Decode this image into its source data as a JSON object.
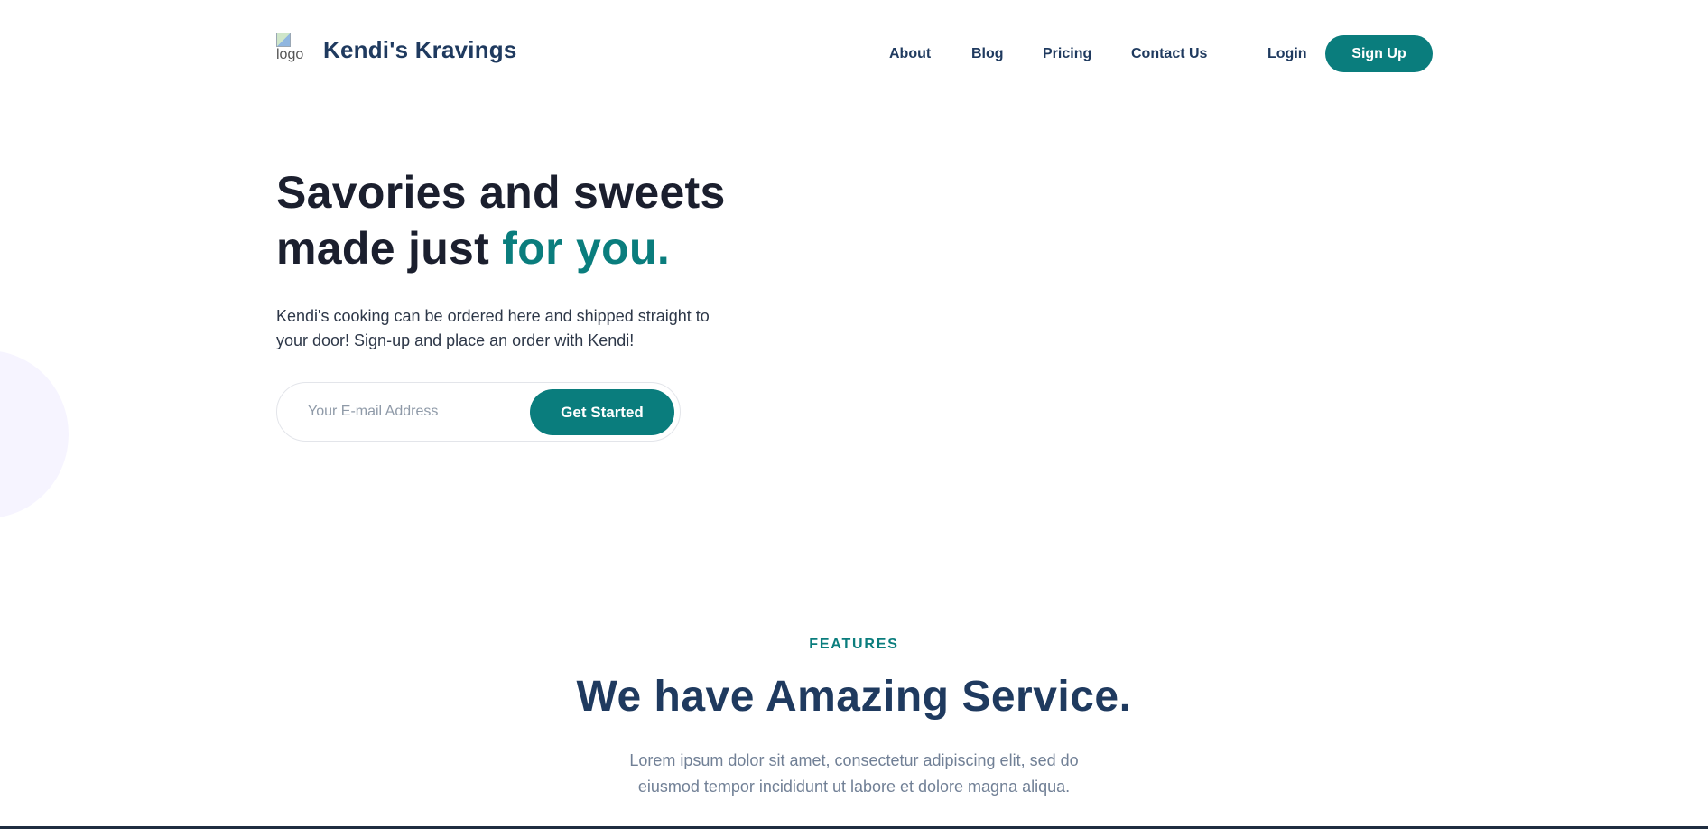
{
  "header": {
    "logo_alt": "logo",
    "brand": "Kendi's Kravings",
    "nav": [
      "About",
      "Blog",
      "Pricing",
      "Contact Us"
    ],
    "login_label": "Login",
    "signup_label": "Sign Up"
  },
  "hero": {
    "title_line1": "Savories and sweets",
    "title_line2_plain": "made just ",
    "title_line2_accent": "for you.",
    "subtitle_line1": "Kendi's cooking can be ordered here and shipped straight to",
    "subtitle_line2": "your door! Sign-up and place an order with Kendi!",
    "email_placeholder": "Your E-mail Address",
    "email_value": "",
    "cta_label": "Get Started"
  },
  "features": {
    "eyebrow": "FEATURES",
    "title": "We have Amazing Service.",
    "subtitle_line1": "Lorem ipsum dolor sit amet, consectetur adipiscing elit, sed do",
    "subtitle_line2": "eiusmod tempor incididunt ut labore et dolore magna aliqua."
  },
  "colors": {
    "accent": "#0a7d7d",
    "brand_text": "#1f3a5f",
    "heading_text": "#1b1f2e",
    "muted_text": "#718096",
    "deco_circle": "#f6f4ff"
  },
  "icons": {
    "logo": "broken-image-icon"
  }
}
